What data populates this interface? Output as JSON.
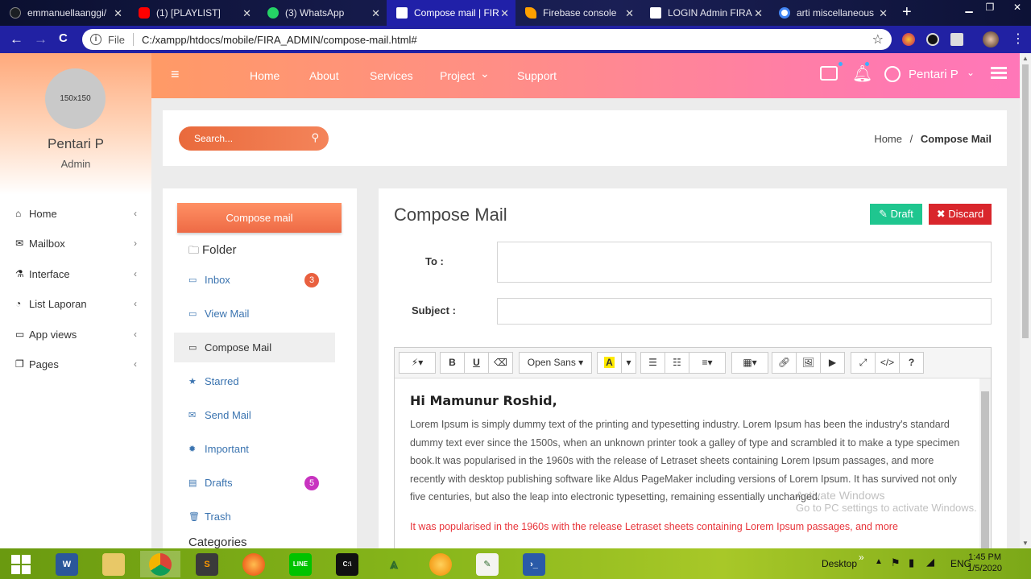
{
  "browser": {
    "tabs": [
      {
        "title": "emmanuellaanggi/",
        "color": "#1b1f23"
      },
      {
        "title": "(1) [PLAYLIST] ",
        "color": "#ff0000"
      },
      {
        "title": "(3) WhatsApp",
        "color": "#25d366"
      },
      {
        "title": "Compose mail | FIR",
        "color": "#ffffff"
      },
      {
        "title": "Firebase console",
        "color": "#ffa000"
      },
      {
        "title": "LOGIN Admin FIRA",
        "color": "#ffffff"
      },
      {
        "title": "arti miscellaneous",
        "color": "#4285f4"
      }
    ],
    "new_tab": "+",
    "back": "←",
    "forward": "→",
    "reload": "C",
    "info": "i",
    "file_label": "File",
    "url": "C:/xampp/htdocs/mobile/FIRA_ADMIN/compose-mail.html#",
    "star": "☆"
  },
  "sidebar": {
    "avatar_text": "150x150",
    "name": "Pentari P",
    "role": "Admin",
    "items": [
      {
        "label": "Home",
        "icon": "home-icon",
        "glyph": "⌂",
        "chev": "‹"
      },
      {
        "label": "Mailbox",
        "icon": "envelope-icon",
        "glyph": "✉",
        "chev": "›"
      },
      {
        "label": "Interface",
        "icon": "flask-icon",
        "glyph": "⚗",
        "chev": "‹"
      },
      {
        "label": "List Laporan",
        "icon": "pie-chart-icon",
        "glyph": "◔",
        "chev": "‹"
      },
      {
        "label": "App views",
        "icon": "desktop-icon",
        "glyph": "▭",
        "chev": "‹"
      },
      {
        "label": "Pages",
        "icon": "files-icon",
        "glyph": "❐",
        "chev": "‹"
      }
    ]
  },
  "topnav": {
    "menu_icon": "≡",
    "links": [
      "Home",
      "About",
      "Services",
      "Project",
      "Support"
    ],
    "project_caret": "⌄",
    "user": "Pentari P",
    "user_caret": "⌄"
  },
  "breadcrumb": {
    "search_placeholder": "Search...",
    "home": "Home",
    "separator": "/",
    "current": "Compose Mail"
  },
  "folders": {
    "compose_button": "Compose mail",
    "folder_heading": "Folder",
    "items": [
      {
        "label": "Inbox",
        "icon": "inbox-icon",
        "glyph": "▭",
        "badge": "3",
        "badge_color": "#e9603f"
      },
      {
        "label": "View Mail",
        "icon": "inbox-icon",
        "glyph": "▭"
      },
      {
        "label": "Compose Mail",
        "icon": "inbox-icon",
        "glyph": "▭"
      },
      {
        "label": "Starred",
        "icon": "star-icon",
        "glyph": "★"
      },
      {
        "label": "Send Mail",
        "icon": "envelope-icon",
        "glyph": "✉"
      },
      {
        "label": "Important",
        "icon": "certificate-icon",
        "glyph": "✹"
      },
      {
        "label": "Drafts",
        "icon": "file-text-icon",
        "glyph": "▤",
        "badge": "5",
        "badge_color": "#c833c0"
      },
      {
        "label": "Trash",
        "icon": "trash-icon",
        "glyph": "🗑"
      }
    ],
    "categories_heading": "Categories"
  },
  "compose": {
    "title": "Compose Mail",
    "draft_label": "Draft",
    "draft_icon": "✎",
    "discard_label": "Discard",
    "discard_icon": "✖",
    "to_label": "To :",
    "to_value": "",
    "subject_label": "Subject :",
    "subject_value": "",
    "toolbar": {
      "font_name": "Open Sans",
      "bold": "B",
      "underline": "U",
      "help": "?"
    },
    "greeting": "Hi Mamunur Roshid,",
    "paragraph1": "Lorem Ipsum is simply dummy text of the printing and typesetting industry. Lorem Ipsum has been the industry's standard dummy text ever since the 1500s, when an unknown printer took a galley of type and scrambled it to make a type specimen book.It was popularised in the 1960s with the release of Letraset sheets containing Lorem Ipsum passages, and more recently with desktop publishing software like Aldus PageMaker including versions of Lorem Ipsum. It has survived not only five centuries, but also the leap into electronic typesetting, remaining essentially unchanged.",
    "paragraph2": "It was popularised in the 1960s with the release Letraset sheets containing Lorem Ipsum passages, and more"
  },
  "watermark": {
    "line1": "Activate Windows",
    "line2": "Go to PC settings to activate Windows."
  },
  "taskbar": {
    "desktop_label": "Desktop",
    "chevron": "»",
    "lang": "ENG",
    "time": "1:45 PM",
    "date": "1/5/2020"
  },
  "colors": {
    "accent_orange": "#f4845a",
    "draft_green": "#1fc68f",
    "discard_red": "#d9262c",
    "link_blue": "#3b74b0"
  }
}
